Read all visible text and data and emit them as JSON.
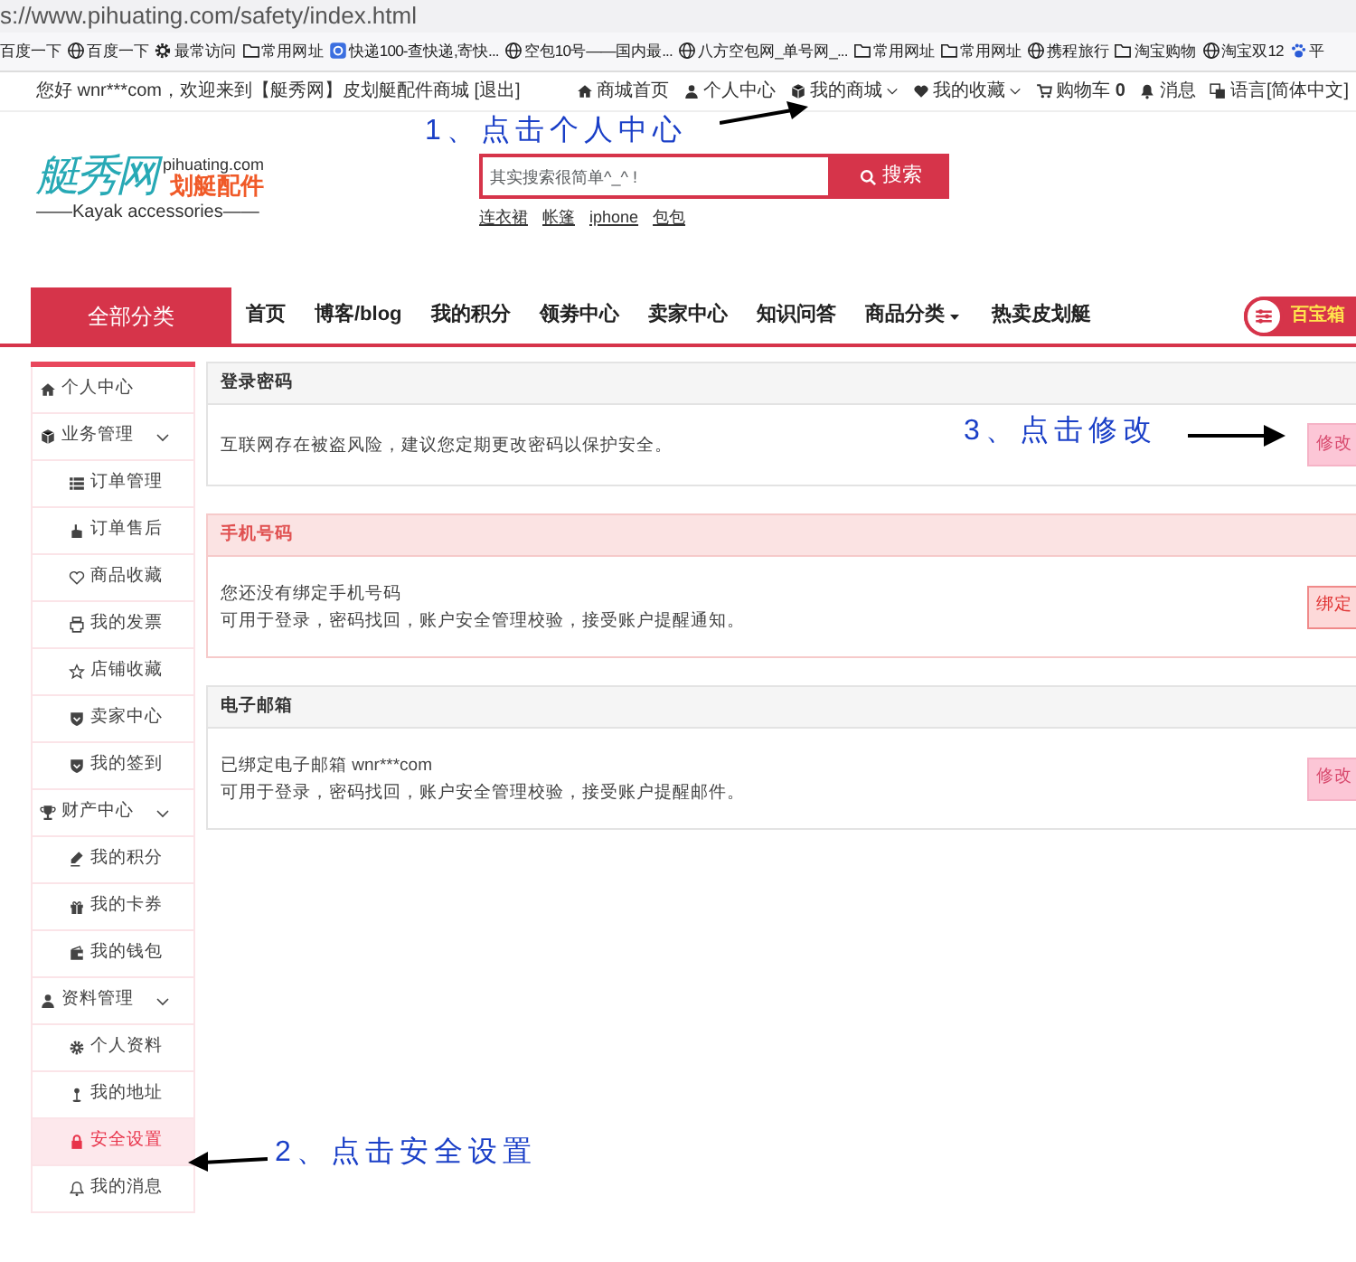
{
  "browser": {
    "url": "s://www.pihuating.com/safety/index.html",
    "bookmarks": [
      {
        "label": "百度一下"
      },
      {
        "label": "百度一下"
      },
      {
        "label": "最常访问"
      },
      {
        "label": "常用网址"
      },
      {
        "label": "快递100-查快递,寄快..."
      },
      {
        "label": "空包10号——国内最..."
      },
      {
        "label": "八方空包网_单号网_..."
      },
      {
        "label": "常用网址"
      },
      {
        "label": "常用网址"
      },
      {
        "label": "携程旅行"
      },
      {
        "label": "淘宝购物"
      },
      {
        "label": "淘宝双12"
      },
      {
        "label": "平"
      }
    ]
  },
  "top_bar": {
    "greeting": "您好 wnr***com，欢迎来到【艇秀网】皮划艇配件商城 [退出]",
    "links": [
      {
        "label": "商城首页",
        "dropdown": false
      },
      {
        "label": "个人中心",
        "dropdown": false
      },
      {
        "label": "我的商城",
        "dropdown": true
      },
      {
        "label": "我的收藏",
        "dropdown": true
      },
      {
        "label": "购物车 **0**",
        "dropdown": false
      },
      {
        "label": "消息",
        "dropdown": false
      },
      {
        "label": "语言[简体中文]",
        "dropdown": false
      }
    ],
    "annotation": "1、点击个人中心"
  },
  "header": {
    "logo": {
      "title": "艇秀网",
      "domain": "pihuating.com",
      "subtitle": "划艇配件",
      "tagline": "——Kayak accessories——"
    },
    "search": {
      "placeholder": "其实搜索很简单^_^ !",
      "button": "搜索"
    },
    "hot_words": [
      "连衣裙",
      "帐篷",
      "iphone",
      "包包"
    ]
  },
  "nav": {
    "category": "全部分类",
    "items": [
      {
        "label": "首页",
        "dropdown": false
      },
      {
        "label": "博客/blog",
        "dropdown": false
      },
      {
        "label": "我的积分",
        "dropdown": false
      },
      {
        "label": "领劵中心",
        "dropdown": false
      },
      {
        "label": "卖家中心",
        "dropdown": false
      },
      {
        "label": "知识问答",
        "dropdown": false
      },
      {
        "label": "商品分类",
        "dropdown": true
      },
      {
        "label": "热卖皮划艇",
        "dropdown": false
      }
    ],
    "toolbox": "百宝箱"
  },
  "sidebar": {
    "items": [
      {
        "label": "个人中心",
        "selected": false
      },
      {
        "label": "业务管理",
        "selected": false,
        "expanded": true,
        "children": [
          {
            "label": "订单管理",
            "selected": false
          },
          {
            "label": "订单售后",
            "selected": false
          },
          {
            "label": "商品收藏",
            "selected": false
          },
          {
            "label": "我的发票",
            "selected": false
          },
          {
            "label": "店铺收藏",
            "selected": false
          },
          {
            "label": "卖家中心",
            "selected": false
          },
          {
            "label": "我的签到",
            "selected": false
          }
        ]
      },
      {
        "label": "财产中心",
        "selected": false,
        "expanded": true,
        "children": [
          {
            "label": "我的积分",
            "selected": false
          },
          {
            "label": "我的卡券",
            "selected": false
          },
          {
            "label": "我的钱包",
            "selected": false
          }
        ]
      },
      {
        "label": "资料管理",
        "selected": false,
        "expanded": true,
        "children": [
          {
            "label": "个人资料",
            "selected": false
          },
          {
            "label": "我的地址",
            "selected": false
          },
          {
            "label": "安全设置",
            "selected": true
          },
          {
            "label": "我的消息",
            "selected": false
          }
        ]
      }
    ],
    "annotation": "2、点击安全设置"
  },
  "sections": [
    {
      "title": "登录密码",
      "kind": "normal",
      "lines": [
        "互联网存在被盗风险，建议您定期更改密码以保护安全。"
      ],
      "button": "修改",
      "annotation": "3、点击修改"
    },
    {
      "title": "手机号码",
      "kind": "warning",
      "lines": [
        "您还没有绑定手机号码",
        "可用于登录，密码找回，账户安全管理校验，接受账户提醒通知。"
      ],
      "button": "绑定"
    },
    {
      "title": "电子邮箱",
      "kind": "normal",
      "lines": [
        "已绑定电子邮箱 wnr***com",
        "可用于登录，密码找回，账户安全管理校验，接受账户提醒邮件。"
      ],
      "button": "修改"
    }
  ]
}
